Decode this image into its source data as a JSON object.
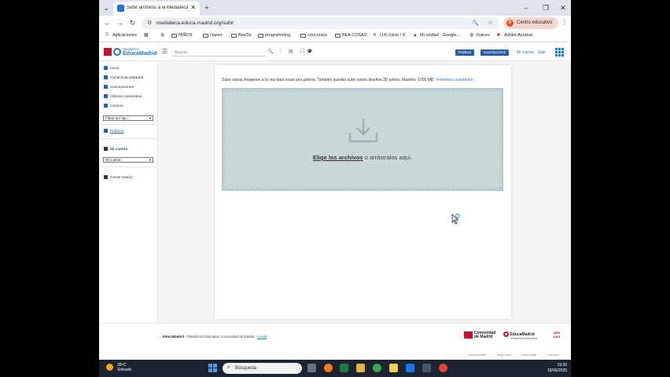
{
  "browser": {
    "tab_title": "Subir archivos a la Mediateca |",
    "url": "mediateca.educa.madrid.org/subir",
    "profile_label": "Centro educativo",
    "profile_initial": "B",
    "bookmarks": [
      "Aplicaciones",
      "NIÑOS",
      "clases",
      "BeaTic",
      "programming",
      "concursos",
      "BEA COSAS",
      "(14) Inicio / X",
      "Mi unidad - Google...",
      "Raices",
      "Adobe Acrobat"
    ]
  },
  "site": {
    "logo_top": "Mediateca",
    "logo_bottom": "EducaMadrid",
    "search_placeholder": "Buscar...",
    "publish_button": "Publicar",
    "subscriptions_button": "Suscripciones",
    "my_account_link": "Mi cuenta",
    "exit_link": "Salir"
  },
  "sidebar": {
    "items": [
      "Inicio",
      "Canal EducaMadrid",
      "Suscripciones",
      "Últimos contenidos",
      "Centros"
    ],
    "filter_select": "Filtrar por tipo...",
    "publish_link": "Publicar",
    "my_account_heading": "Mi cuenta",
    "account_select": "Mi cuenta...",
    "logout": "Cerrar sesión"
  },
  "upload": {
    "intro": "Sube varias imágenes a la vez para crear una galería. También puedes subir varios diseños 3D juntos. Máximo: 1000 MB -",
    "formats_link": "Formatos aceptados",
    "choose_files": "Elige los archivos",
    "drag_text": "o arrástralos aquí."
  },
  "footer": {
    "brand": "EducaMadrid",
    "text": "- Plataforma Educativa. Comunidad de Madrid -",
    "help_link": "Ayuda",
    "logo1_line1": "Comunidad",
    "logo1_line2": "de Madrid",
    "logo2": "EducaMadrid",
    "logo2_sub": "Plataforma Educativa",
    "logo3": "DRS DAS",
    "links": [
      "Accesibilidad",
      "Mapa web",
      "Aviso legal",
      "Contacto"
    ]
  },
  "taskbar": {
    "temperature": "35ºC",
    "weather": "Soleado",
    "search": "Búsqueda",
    "time": "19:26",
    "date": "18/06/2025"
  }
}
